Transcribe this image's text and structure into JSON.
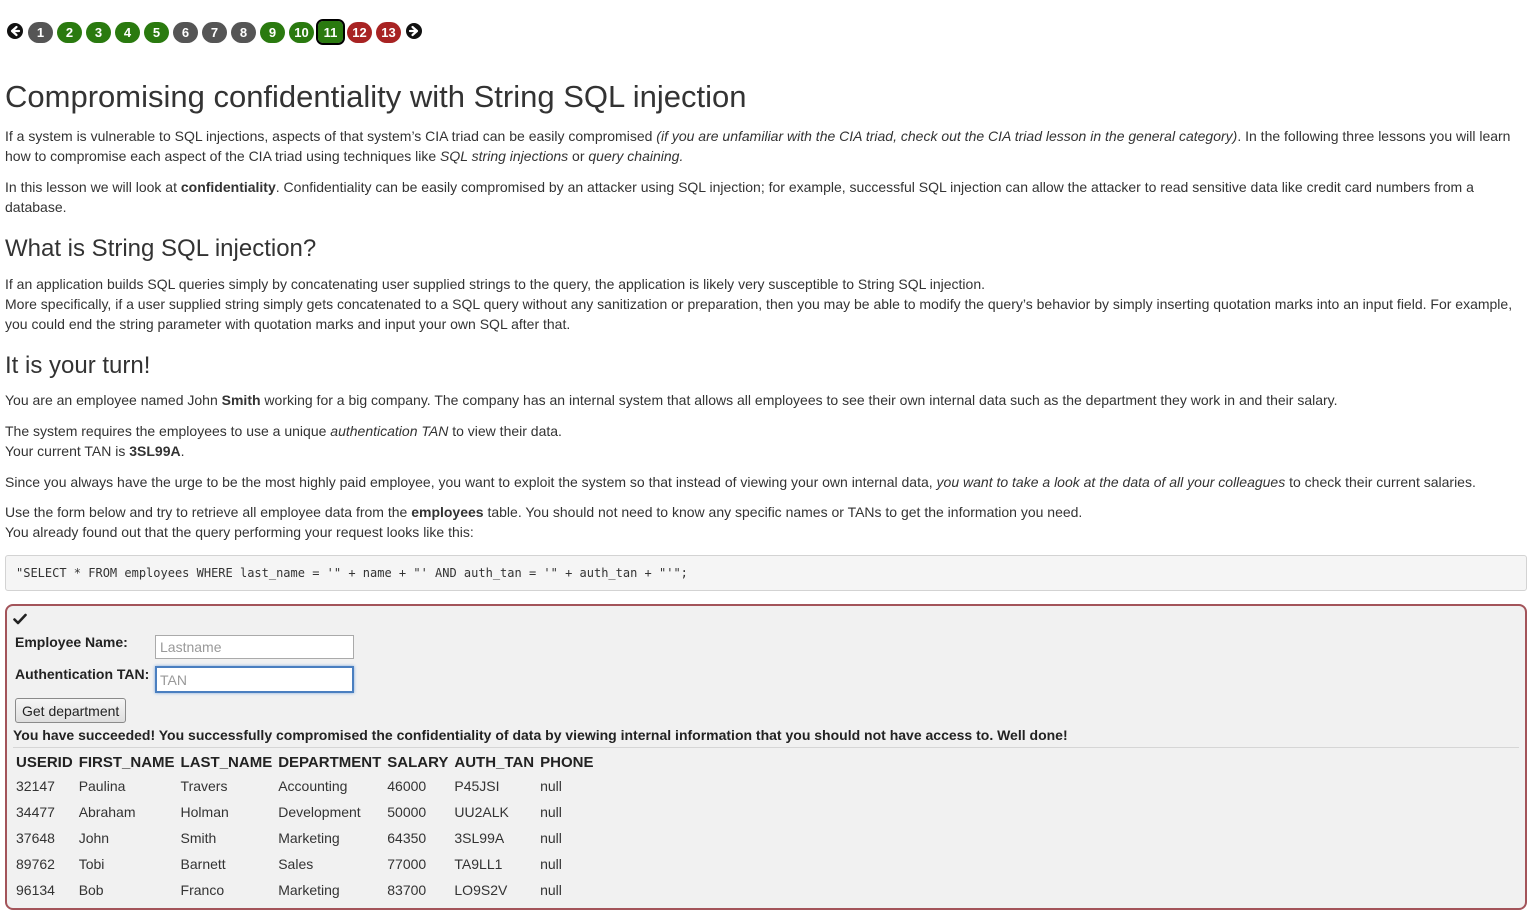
{
  "pager": {
    "prev_icon": "arrow-left-circle-icon",
    "next_icon": "arrow-right-circle-icon",
    "pages": [
      {
        "label": "1",
        "status": "grey"
      },
      {
        "label": "2",
        "status": "green"
      },
      {
        "label": "3",
        "status": "green"
      },
      {
        "label": "4",
        "status": "green"
      },
      {
        "label": "5",
        "status": "green"
      },
      {
        "label": "6",
        "status": "grey"
      },
      {
        "label": "7",
        "status": "grey"
      },
      {
        "label": "8",
        "status": "grey"
      },
      {
        "label": "9",
        "status": "green"
      },
      {
        "label": "10",
        "status": "green"
      },
      {
        "label": "11",
        "status": "green",
        "current": true
      },
      {
        "label": "12",
        "status": "red"
      },
      {
        "label": "13",
        "status": "red"
      }
    ],
    "colors": {
      "grey": "#555555",
      "green": "#2a7a0f",
      "red": "#a82323"
    }
  },
  "lesson": {
    "title": "Compromising confidentiality with String SQL injection",
    "intro_1": "If a system is vulnerable to SQL injections, aspects of that system’s CIA triad can be easily compromised ",
    "intro_1_em": "(if you are unfamiliar with the CIA triad, check out the CIA triad lesson in the general category)",
    "intro_1_b": ". In the following three lessons you will learn how to compromise each aspect of the CIA triad using techniques like ",
    "intro_1_em2": "SQL string injections",
    "intro_1_c": " or ",
    "intro_1_em3": "query chaining.",
    "intro_2_a": "In this lesson we will look at ",
    "intro_2_strong": "confidentiality",
    "intro_2_b": ". Confidentiality can be easily compromised by an attacker using SQL injection; for example, successful SQL injection can allow the attacker to read sensitive data like credit card numbers from a database.",
    "h2_what": "What is String SQL injection?",
    "what_1": "If an application builds SQL queries simply by concatenating user supplied strings to the query, the application is likely very susceptible to String SQL injection.",
    "what_2": "More specifically, if a user supplied string simply gets concatenated to a SQL query without any sanitization or preparation, then you may be able to modify the query’s behavior by simply inserting quotation marks into an input field. For example, you could end the string parameter with quotation marks and input your own SQL after that.",
    "h2_turn": "It is your turn!",
    "turn_1_a": "You are an employee named John ",
    "turn_1_strong": "Smith",
    "turn_1_b": " working for a big company. The company has an internal system that allows all employees to see their own internal data such as the department they work in and their salary.",
    "turn_2_a": "The system requires the employees to use a unique ",
    "turn_2_em": "authentication TAN",
    "turn_2_b": " to view their data.",
    "turn_3_a": "Your current TAN is ",
    "turn_3_strong": "3SL99A",
    "turn_3_b": ".",
    "turn_4_a": "Since you always have the urge to be the most highly paid employee, you want to exploit the system so that instead of viewing your own internal data, ",
    "turn_4_em": "you want to take a look at the data of all your colleagues",
    "turn_4_b": " to check their current salaries.",
    "turn_5_a": "Use the form below and try to retrieve all employee data from the ",
    "turn_5_strong": "employees",
    "turn_5_b": " table. You should not need to know any specific names or TANs to get the information you need.",
    "turn_6": "You already found out that the query performing your request looks like this:",
    "query": "\"SELECT * FROM employees WHERE last_name = '\" + name + \"' AND auth_tan = '\" + auth_tan + \"'\";"
  },
  "form": {
    "check_icon": "checkmark-icon",
    "name_label": "Employee Name:",
    "name_placeholder": "Lastname",
    "name_value": "",
    "tan_label": "Authentication TAN:",
    "tan_placeholder": "TAN",
    "tan_value": "",
    "submit_label": "Get department",
    "feedback": "You have succeeded! You successfully compromised the confidentiality of data by viewing internal information that you should not have access to. Well done!"
  },
  "results": {
    "columns": [
      "USERID",
      "FIRST_NAME",
      "LAST_NAME",
      "DEPARTMENT",
      "SALARY",
      "AUTH_TAN",
      "PHONE"
    ],
    "rows": [
      [
        "32147",
        "Paulina",
        "Travers",
        "Accounting",
        "46000",
        "P45JSI",
        "null"
      ],
      [
        "34477",
        "Abraham",
        "Holman",
        "Development",
        "50000",
        "UU2ALK",
        "null"
      ],
      [
        "37648",
        "John",
        "Smith",
        "Marketing",
        "64350",
        "3SL99A",
        "null"
      ],
      [
        "89762",
        "Tobi",
        "Barnett",
        "Sales",
        "77000",
        "TA9LL1",
        "null"
      ],
      [
        "96134",
        "Bob",
        "Franco",
        "Marketing",
        "83700",
        "LO9S2V",
        "null"
      ]
    ]
  }
}
